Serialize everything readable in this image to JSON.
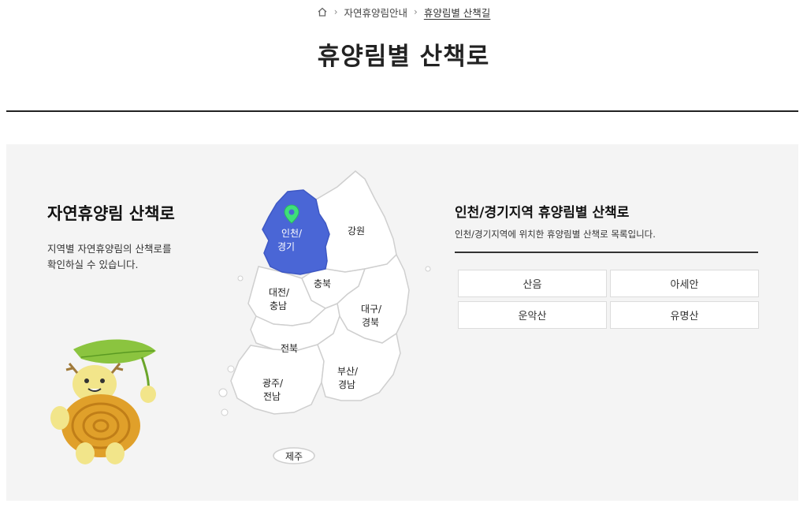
{
  "breadcrumb": {
    "home_icon": "home-icon",
    "items": [
      "자연휴양림안내",
      "휴양림별 산책길"
    ]
  },
  "page": {
    "title": "휴양림별 산책로"
  },
  "intro": {
    "title": "자연휴양림 산책로",
    "desc_line1": "지역별 자연휴양림의 산책로를",
    "desc_line2": "확인하실 수 있습니다."
  },
  "map": {
    "active_color": "#4a66d6",
    "regions": {
      "incheon_gyeonggi": [
        "인천/",
        "경기"
      ],
      "gangwon": "강원",
      "chungbuk": "충북",
      "daejeon_chungnam": [
        "대전/",
        "충남"
      ],
      "daegu_gyeongbuk": [
        "대구/",
        "경북"
      ],
      "jeonbuk": "전북",
      "gwangju_jeonnam": [
        "광주/",
        "전남"
      ],
      "busan_gyeongnam": [
        "부산/",
        "경남"
      ],
      "jeju": "제주"
    },
    "active_region": "incheon_gyeonggi",
    "pin_icon": "location-pin-icon"
  },
  "list": {
    "title": "인천/경기지역 휴양림별 산책로",
    "desc": "인천/경기지역에 위치한 휴양림별 산책로 목록입니다.",
    "forests": [
      "산음",
      "아세안",
      "운악산",
      "유명산"
    ]
  }
}
